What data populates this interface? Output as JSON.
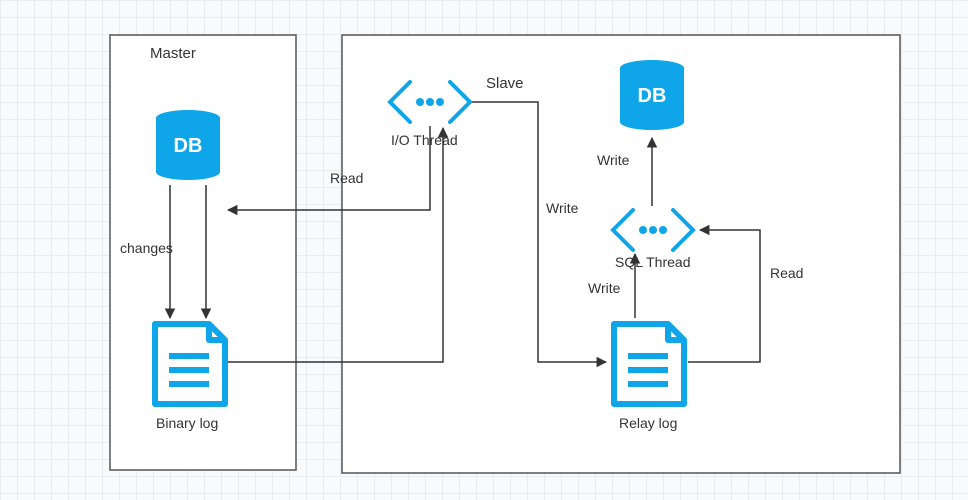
{
  "diagram": {
    "master": {
      "title": "Master",
      "db_label": "DB",
      "binary_log": "Binary log",
      "changes": "changes"
    },
    "slave": {
      "title": "Slave",
      "db_label": "DB",
      "io_thread": "I/O Thread",
      "sql_thread": "SQL Thread",
      "relay_log": "Relay log"
    },
    "edges": {
      "read_master": "Read",
      "write_relay": "Write",
      "write_db": "Write",
      "read_relay": "Read",
      "write_sql": "Write"
    },
    "colors": {
      "accent": "#0ea5e9",
      "stroke": "#555"
    }
  }
}
